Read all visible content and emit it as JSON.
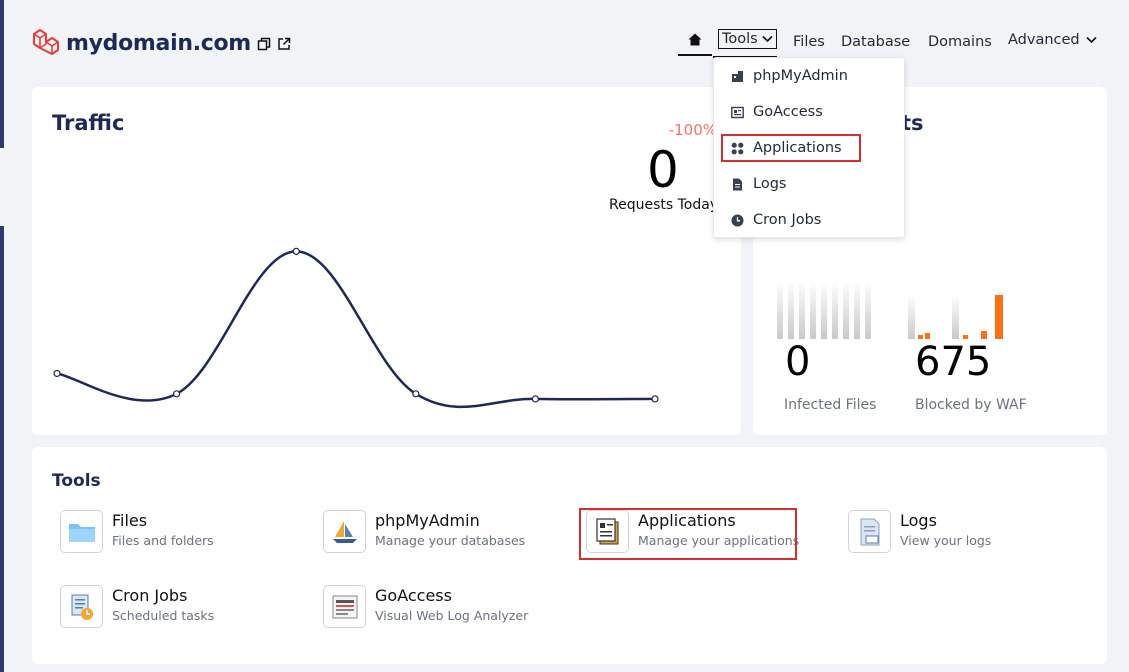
{
  "header": {
    "domain": "mydomain.com",
    "nav": {
      "tools": "Tools",
      "files": "Files",
      "database": "Database",
      "domains": "Domains",
      "advanced": "Advanced"
    }
  },
  "dropdown": {
    "items": [
      {
        "label": "phpMyAdmin",
        "icon": "database-icon"
      },
      {
        "label": "GoAccess",
        "icon": "report-icon"
      },
      {
        "label": "Applications",
        "icon": "grid-icon"
      },
      {
        "label": "Logs",
        "icon": "file-icon"
      },
      {
        "label": "Cron Jobs",
        "icon": "clock-icon"
      }
    ]
  },
  "traffic": {
    "title": "Traffic",
    "change": "-100%",
    "requests_value": "0",
    "requests_label": "Requests Today"
  },
  "security": {
    "title_partial": "ts",
    "infected_value": "0",
    "infected_label": "Infected Files",
    "waf_value": "675",
    "waf_label": "Blocked by WAF"
  },
  "tools": {
    "title": "Tools",
    "items": [
      {
        "name": "Files",
        "desc": "Files and folders",
        "icon": "folder-icon"
      },
      {
        "name": "phpMyAdmin",
        "desc": "Manage your databases",
        "icon": "phpmyadmin-icon"
      },
      {
        "name": "Applications",
        "desc": "Manage your applications",
        "icon": "applications-icon"
      },
      {
        "name": "Logs",
        "desc": "View your logs",
        "icon": "log-file-icon"
      },
      {
        "name": "Cron Jobs",
        "desc": "Scheduled tasks",
        "icon": "cron-icon"
      },
      {
        "name": "GoAccess",
        "desc": "Visual Web Log Analyzer",
        "icon": "goaccess-icon"
      }
    ]
  },
  "chart_data": {
    "type": "line",
    "values": [
      2,
      0,
      14,
      0,
      -0.5,
      -0.5
    ],
    "ylim": [
      -1,
      16
    ]
  },
  "colors": {
    "brand": "#e53e3e",
    "navy": "#1e2a55",
    "highlight": "#d32f2f",
    "waf_orange": "#f97316"
  }
}
